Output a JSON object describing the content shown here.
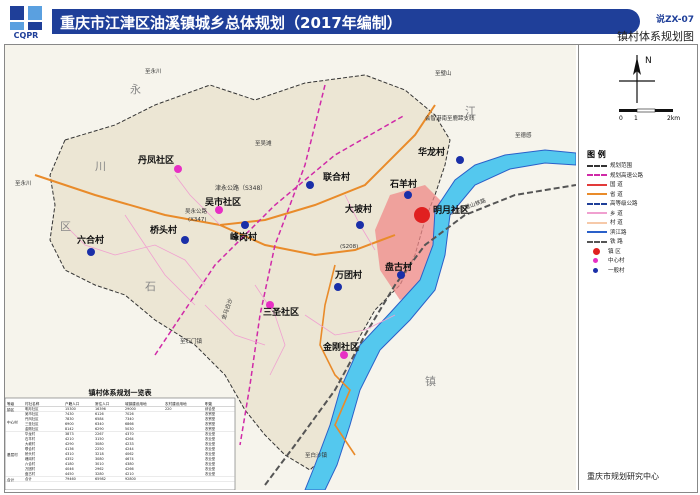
{
  "header": {
    "logo_text": "CQPR",
    "title": "重庆市江津区油溪镇城乡总体规划（2017年编制）",
    "code": "说ZX-07",
    "subtitle": "镇村体系规划图"
  },
  "map": {
    "colors": {
      "land": "#f3efe4",
      "river": "#54c8ee",
      "town_area": "#f08a8a",
      "provincial_road": "#e98b2a",
      "highway": "#d02aa8",
      "railway": "#555555"
    },
    "settlements": [
      {
        "id": "yuexi",
        "name": "明月社区",
        "kind": "town"
      },
      {
        "id": "huanglong",
        "name": "华龙村",
        "kind": "village"
      },
      {
        "id": "shiyang",
        "name": "石羊村",
        "kind": "village"
      },
      {
        "id": "dapo",
        "name": "大坡村",
        "kind": "village"
      },
      {
        "id": "lianhe",
        "name": "联合村",
        "kind": "village"
      },
      {
        "id": "wushi",
        "name": "吴市社区",
        "kind": "center"
      },
      {
        "id": "danfeng",
        "name": "丹凤社区",
        "kind": "center"
      },
      {
        "id": "qiaotou",
        "name": "桥头村",
        "kind": "village"
      },
      {
        "id": "fenggang",
        "name": "峰岗村",
        "kind": "village"
      },
      {
        "id": "liuhe",
        "name": "六合村",
        "kind": "village"
      },
      {
        "id": "wantuan",
        "name": "万团村",
        "kind": "village"
      },
      {
        "id": "pangu",
        "name": "盘古村",
        "kind": "village"
      },
      {
        "id": "sansheng",
        "name": "三圣社区",
        "kind": "center"
      },
      {
        "id": "jingang",
        "name": "金刚社区",
        "kind": "center"
      }
    ],
    "road_labels": [
      {
        "id": "r1",
        "text": "津永公路（S348）"
      },
      {
        "id": "r2",
        "text": "吴永公路"
      },
      {
        "id": "r3",
        "text": "(X347)"
      },
      {
        "id": "r4",
        "text": "(S208)"
      },
      {
        "id": "r5",
        "text": "金马白沙"
      },
      {
        "id": "r6",
        "text": "至吴滩"
      },
      {
        "id": "r7",
        "text": "至永川"
      },
      {
        "id": "r8",
        "text": "至永川"
      },
      {
        "id": "r9",
        "text": "至石门镇"
      },
      {
        "id": "r10",
        "text": "至白沙镇"
      },
      {
        "id": "r11",
        "text": "至德感"
      },
      {
        "id": "r12",
        "text": "至璧山"
      },
      {
        "id": "r13",
        "text": "会智港南至鹿蹄支线"
      },
      {
        "id": "r14",
        "text": "江津至璧山铁路"
      }
    ],
    "area_labels": [
      "永",
      "川",
      "区",
      "石",
      "镇",
      "江"
    ]
  },
  "compass": {
    "north": "N",
    "scale_0": "0",
    "scale_1": "1",
    "scale_2": "2km"
  },
  "legend": {
    "title": "图  例",
    "items": [
      {
        "label": "规划范围",
        "color": "#333333",
        "style": "dash"
      },
      {
        "label": "规划高速公路",
        "color": "#d02aa8",
        "style": "dash"
      },
      {
        "label": "国  道",
        "color": "#e23a3a",
        "style": "solid"
      },
      {
        "label": "省  道",
        "color": "#e98b2a",
        "style": "solid"
      },
      {
        "label": "高等级公路",
        "color": "#1f3f99",
        "style": "dash"
      },
      {
        "label": "乡  道",
        "color": "#f0a0d0",
        "style": "solid"
      },
      {
        "label": "村  道",
        "color": "#f6c9a9",
        "style": "solid"
      },
      {
        "label": "滨江路",
        "color": "#2a60c9",
        "style": "solid"
      },
      {
        "label": "铁  路",
        "color": "#555555",
        "style": "rail"
      },
      {
        "label": "镇  区",
        "color": "#e02020",
        "style": "dot-large"
      },
      {
        "label": "中心村",
        "color": "#e72fc4",
        "style": "dot"
      },
      {
        "label": "一般村",
        "color": "#1a2fa8",
        "style": "dot"
      }
    ]
  },
  "table": {
    "title": "镇村体系规划一览表",
    "col_headers": [
      "等级",
      "村社名称",
      "户籍人口",
      "常住人口",
      "城镇建设用地",
      "农村建设用地",
      "职能"
    ],
    "groups": [
      {
        "level": "镇区",
        "rows": [
          [
            "明月社区",
            "15300",
            "16396",
            "29000",
            "220",
            "",
            "综合型"
          ]
        ]
      },
      {
        "level": "中心村",
        "rows": [
          [
            "吴市社区",
            "7430",
            "6126",
            "7026",
            "",
            "",
            "农贸型"
          ],
          [
            "丹凤社区",
            "7830",
            "6584",
            "7340",
            "",
            "",
            "农贸型"
          ],
          [
            "三圣社区",
            "6900",
            "6340",
            "6866",
            "",
            "",
            "农贸型"
          ],
          [
            "金刚社区",
            "8142",
            "6290",
            "5030",
            "",
            "",
            "农贸型"
          ]
        ]
      },
      {
        "level": "基层村",
        "rows": [
          [
            "华龙村",
            "3873",
            "2267",
            "4370",
            "",
            "",
            "农业型"
          ],
          [
            "石羊村",
            "4210",
            "3150",
            "4264",
            "",
            "",
            "农业型"
          ],
          [
            "大坡村",
            "4290",
            "3080",
            "4233",
            "",
            "",
            "农业型"
          ],
          [
            "联合村",
            "4136",
            "2250",
            "4244",
            "",
            "",
            "农业型"
          ],
          [
            "桥头村",
            "4310",
            "3218",
            "4062",
            "",
            "",
            "农业型"
          ],
          [
            "峰岗村",
            "4352",
            "3080",
            "4674",
            "",
            "",
            "农业型"
          ],
          [
            "六合村",
            "4180",
            "3010",
            "4380",
            "",
            "",
            "农业型"
          ],
          [
            "万团村",
            "4046",
            "2962",
            "4266",
            "",
            "",
            "农业型"
          ],
          [
            "盘古村",
            "4450",
            "3280",
            "4210",
            "",
            "",
            "农业型"
          ]
        ]
      },
      {
        "level": "合计",
        "rows": [
          [
            "合计",
            "79460",
            "65982",
            "92800",
            "",
            "",
            ""
          ]
        ]
      }
    ]
  },
  "footer": {
    "institute": "重庆市规划研究中心"
  }
}
